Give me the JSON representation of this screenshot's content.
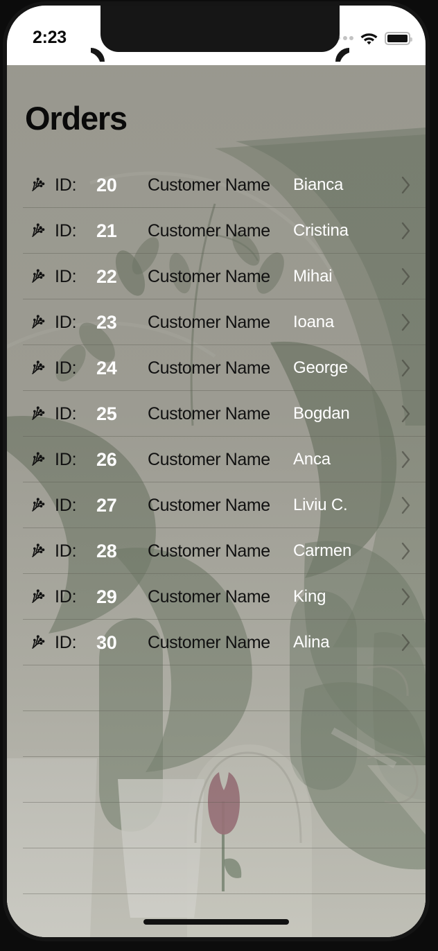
{
  "device": {
    "home_indicator": "home-indicator"
  },
  "status_bar": {
    "time": "2:23",
    "signal_icon": "signal-dots-icon",
    "wifi_icon": "wifi-icon",
    "battery_icon": "battery-icon"
  },
  "screen": {
    "title": "Orders"
  },
  "colors": {
    "title_text": "#0a0a0a",
    "row_label_text": "#111111",
    "row_value_text": "#ffffff",
    "separator": "rgba(90,90,80,0.40)",
    "chevron": "rgba(70,70,62,0.62)",
    "status_bar_bg": "#ffffff",
    "wallpaper_base": "#dcdcd3",
    "wallpaper_leaf": "#8b9a86",
    "wallpaper_flower": "#b2818c"
  },
  "list": {
    "row_icon": "sprig-icon",
    "chevron_icon": "chevron-right-icon",
    "id_label": "ID:",
    "name_label": "Customer Name",
    "empty_row_count": 6,
    "rows": [
      {
        "id": "20",
        "name": "Bianca"
      },
      {
        "id": "21",
        "name": "Cristina"
      },
      {
        "id": "22",
        "name": "Mihai"
      },
      {
        "id": "23",
        "name": "Ioana"
      },
      {
        "id": "24",
        "name": "George"
      },
      {
        "id": "25",
        "name": "Bogdan"
      },
      {
        "id": "26",
        "name": "Anca"
      },
      {
        "id": "27",
        "name": "Liviu C."
      },
      {
        "id": "28",
        "name": "Carmen"
      },
      {
        "id": "29",
        "name": "King"
      },
      {
        "id": "30",
        "name": "Alina"
      }
    ]
  }
}
